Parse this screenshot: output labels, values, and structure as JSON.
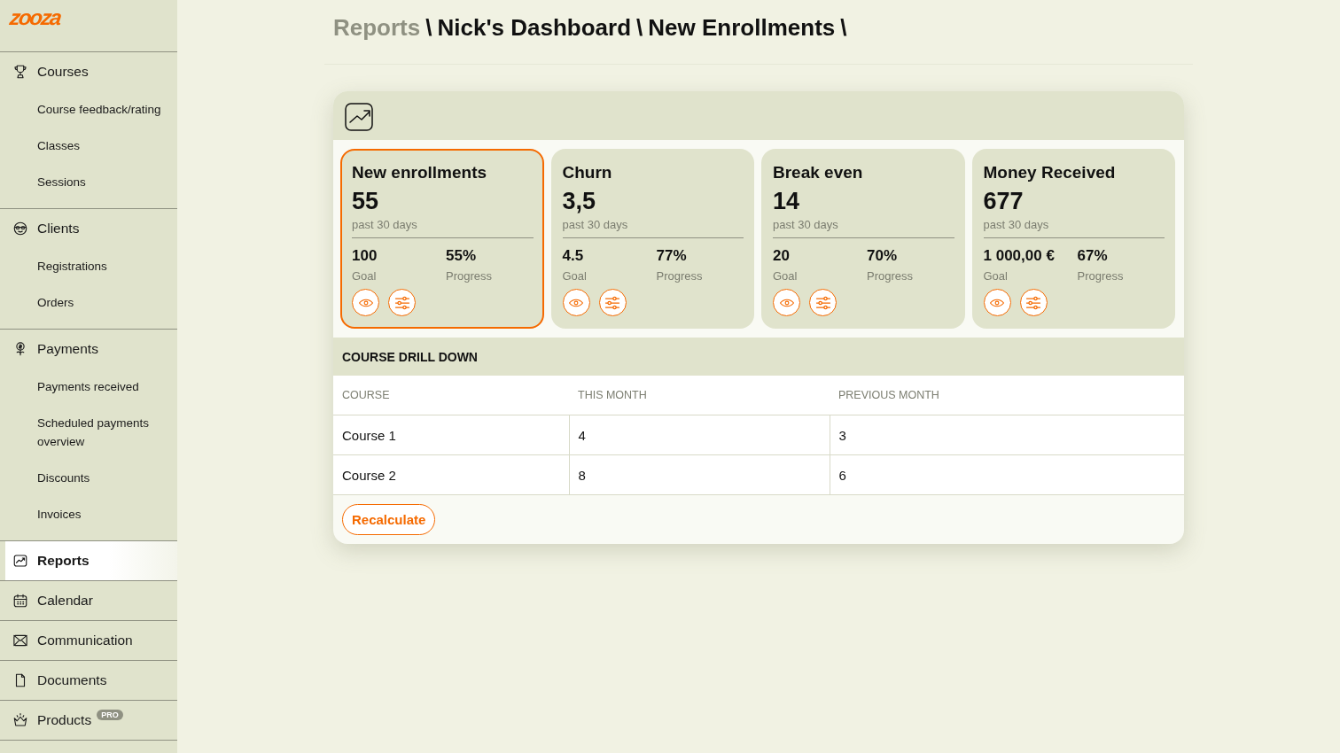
{
  "logo": "zooza",
  "sidebar": {
    "items": [
      {
        "label": "Courses",
        "selected": false,
        "children": [
          {
            "label": "Course feedback/rating"
          },
          {
            "label": "Classes"
          },
          {
            "label": "Sessions"
          }
        ]
      },
      {
        "label": "Clients",
        "selected": false,
        "children": [
          {
            "label": "Registrations"
          },
          {
            "label": "Orders"
          }
        ]
      },
      {
        "label": "Payments",
        "selected": false,
        "children": [
          {
            "label": "Payments received"
          },
          {
            "label": "Scheduled payments overview"
          },
          {
            "label": "Discounts"
          },
          {
            "label": "Invoices"
          }
        ]
      },
      {
        "label": "Reports",
        "selected": true
      },
      {
        "label": "Calendar",
        "selected": false
      },
      {
        "label": "Communication",
        "selected": false
      },
      {
        "label": "Documents",
        "selected": false
      },
      {
        "label": "Products",
        "selected": false,
        "badge": "PRO"
      }
    ]
  },
  "breadcrumb": [
    {
      "label": "Reports",
      "kind": "link",
      "separator": "\\"
    },
    {
      "label": "Nick's Dashboard",
      "kind": "current",
      "separator": "\\"
    },
    {
      "label": "New Enrollments",
      "kind": "current",
      "separator": "\\"
    }
  ],
  "metrics": [
    {
      "title": "New enrollments",
      "value": "55",
      "period": "past 30 days",
      "goal": "100",
      "goal_label": "Goal",
      "progress": "55%",
      "progress_label": "Progress",
      "selected": true
    },
    {
      "title": "Churn",
      "value": "3,5",
      "period": "past 30 days",
      "goal": "4.5",
      "goal_label": "Goal",
      "progress": "77%",
      "progress_label": "Progress",
      "selected": false
    },
    {
      "title": "Break even",
      "value": "14",
      "period": "past 30 days",
      "goal": "20",
      "goal_label": "Goal",
      "progress": "70%",
      "progress_label": "Progress",
      "selected": false
    },
    {
      "title": "Money Received",
      "value": "677",
      "period": "past 30 days",
      "goal": "1 000,00 €",
      "goal_label": "Goal",
      "progress": "67%",
      "progress_label": "Progress",
      "selected": false
    }
  ],
  "drill_down": {
    "title": "COURSE DRILL DOWN",
    "columns": [
      "COURSE",
      "THIS MONTH",
      "PREVIOUS MONTH"
    ],
    "rows": [
      [
        "Course 1",
        "4",
        "3"
      ],
      [
        "Course 2",
        "8",
        "6"
      ]
    ]
  },
  "recalculate_button": "Recalculate"
}
